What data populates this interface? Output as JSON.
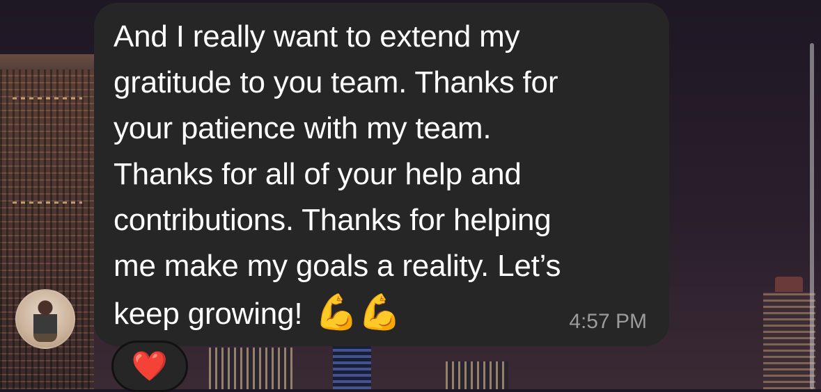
{
  "message": {
    "lines": [
      "And I really want to extend my",
      "gratitude to you team. Thanks for",
      "your patience with my team.",
      "Thanks for all of your help and",
      "contributions. Thanks for helping",
      "me make my goals a reality. Let’s",
      "keep growing!"
    ],
    "emoji": "💪💪",
    "timestamp": "4:57 PM"
  },
  "reaction": {
    "emoji": "❤️"
  },
  "icons": {
    "reaction": "red-heart-icon",
    "avatar": "sender-avatar"
  },
  "colors": {
    "bubble": "#262626",
    "text": "#ffffff",
    "timestamp": "#9b9b9b",
    "reaction_heart": "#e8102a"
  }
}
